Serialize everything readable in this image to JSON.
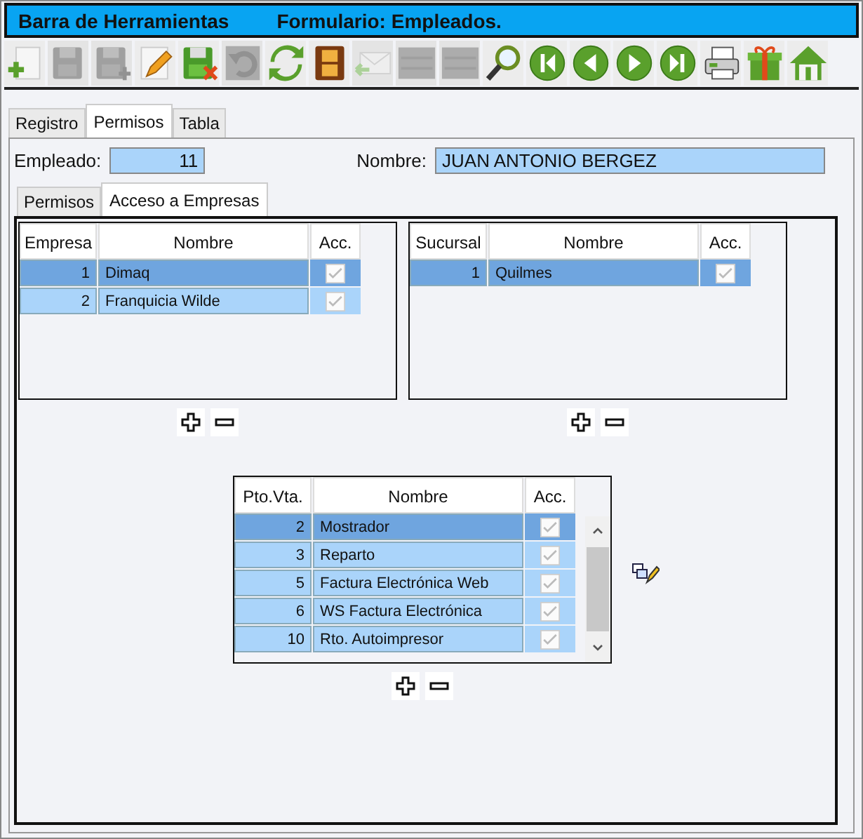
{
  "title_bar": {
    "title": "Barra de Herramientas",
    "form": "Formulario: Empleados."
  },
  "toolbar": [
    {
      "kind": "new",
      "disabled": false
    },
    {
      "kind": "save",
      "disabled": true
    },
    {
      "kind": "saveadd",
      "disabled": true
    },
    {
      "kind": "edit",
      "disabled": false
    },
    {
      "kind": "savecancel",
      "disabled": false
    },
    {
      "kind": "undo",
      "disabled": true
    },
    {
      "kind": "refresh",
      "disabled": false
    },
    {
      "kind": "film",
      "disabled": false
    },
    {
      "kind": "mail",
      "disabled": true
    },
    {
      "kind": "list",
      "disabled": true
    },
    {
      "kind": "list",
      "disabled": true
    },
    {
      "kind": "search",
      "disabled": false
    },
    {
      "kind": "first",
      "disabled": false
    },
    {
      "kind": "prev",
      "disabled": false
    },
    {
      "kind": "next",
      "disabled": false
    },
    {
      "kind": "last",
      "disabled": false
    },
    {
      "kind": "print",
      "disabled": false
    },
    {
      "kind": "gift",
      "disabled": false
    },
    {
      "kind": "home",
      "disabled": false
    }
  ],
  "tabs": [
    {
      "label": "Registro",
      "selected": false
    },
    {
      "label": "Permisos",
      "selected": true
    },
    {
      "label": "Tabla",
      "selected": false
    }
  ],
  "fields": {
    "employee_label": "Empleado:",
    "employee_value": "11",
    "name_label": "Nombre:",
    "name_value": "JUAN ANTONIO BERGEZ"
  },
  "subtabs": [
    {
      "label": "Permisos",
      "selected": false
    },
    {
      "label": "Acceso a Empresas",
      "selected": true
    }
  ],
  "grids": [
    {
      "columns": [
        "Empresa",
        "Nombre",
        "Acc."
      ],
      "rows": [
        {
          "code": "1",
          "name": "Dimaq",
          "access": true,
          "selected": true
        },
        {
          "code": "2",
          "name": "Franquicia Wilde",
          "access": true,
          "selected": false
        }
      ]
    },
    {
      "columns": [
        "Sucursal",
        "Nombre",
        "Acc."
      ],
      "rows": [
        {
          "code": "1",
          "name": "Quilmes",
          "access": true,
          "selected": true
        }
      ]
    },
    {
      "columns": [
        "Pto.Vta.",
        "Nombre",
        "Acc."
      ],
      "scrollbar": true,
      "rows": [
        {
          "code": "2",
          "name": "Mostrador",
          "access": true,
          "selected": true
        },
        {
          "code": "3",
          "name": "Reparto",
          "access": true,
          "selected": false
        },
        {
          "code": "5",
          "name": "Factura Electrónica Web",
          "access": true,
          "selected": false
        },
        {
          "code": "6",
          "name": "WS Factura Electrónica",
          "access": true,
          "selected": false
        },
        {
          "code": "10",
          "name": "Rto. Autoimpresor",
          "access": true,
          "selected": false
        }
      ]
    }
  ]
}
